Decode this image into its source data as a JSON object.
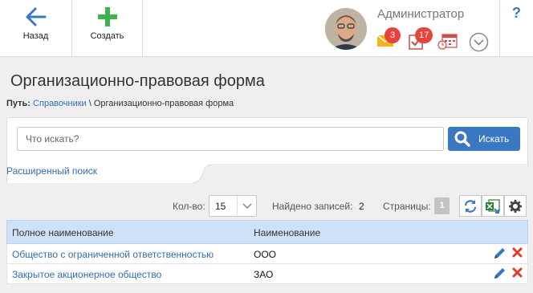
{
  "toolbar": {
    "back_label": "Назад",
    "create_label": "Создать",
    "user_name": "Администратор",
    "mail_count": "3",
    "tasks_count": "17",
    "help_label": "?"
  },
  "page": {
    "title": "Организационно-правовая форма"
  },
  "breadcrumb": {
    "prefix": "Путь:",
    "link": "Справочники",
    "separator": " \\ ",
    "current": "Организационно-правовая форма"
  },
  "search": {
    "placeholder": "Что искать?",
    "button_label": "Искать",
    "advanced_label": "Расширенный поиск"
  },
  "controls": {
    "count_label": "Кол-во:",
    "count_value": "15",
    "found_label": "Найдено записей:",
    "found_value": "2",
    "pages_label": "Страницы:",
    "current_page": "1"
  },
  "table": {
    "columns": [
      "Полное наименование",
      "Наименование"
    ],
    "rows": [
      {
        "full_name": "Общество с ограниченной ответственностью",
        "short_name": "ООО"
      },
      {
        "full_name": "Закрытое акционерное общество",
        "short_name": "ЗАО"
      }
    ]
  },
  "colors": {
    "accent": "#3a78c3",
    "create_green": "#3cb44b",
    "badge_red": "#e8423c",
    "header_blue": "#cde2f6",
    "delete_red": "#e03b2e"
  },
  "icons": {
    "back": "arrow-left-icon",
    "create": "plus-icon",
    "mail": "envelope-icon",
    "tasks": "checklist-icon",
    "calendar": "calendar-icon",
    "dropdown": "chevron-down-icon",
    "refresh": "refresh-icon",
    "export": "excel-export-icon",
    "settings": "gear-icon",
    "edit": "pencil-icon",
    "delete": "close-icon"
  }
}
